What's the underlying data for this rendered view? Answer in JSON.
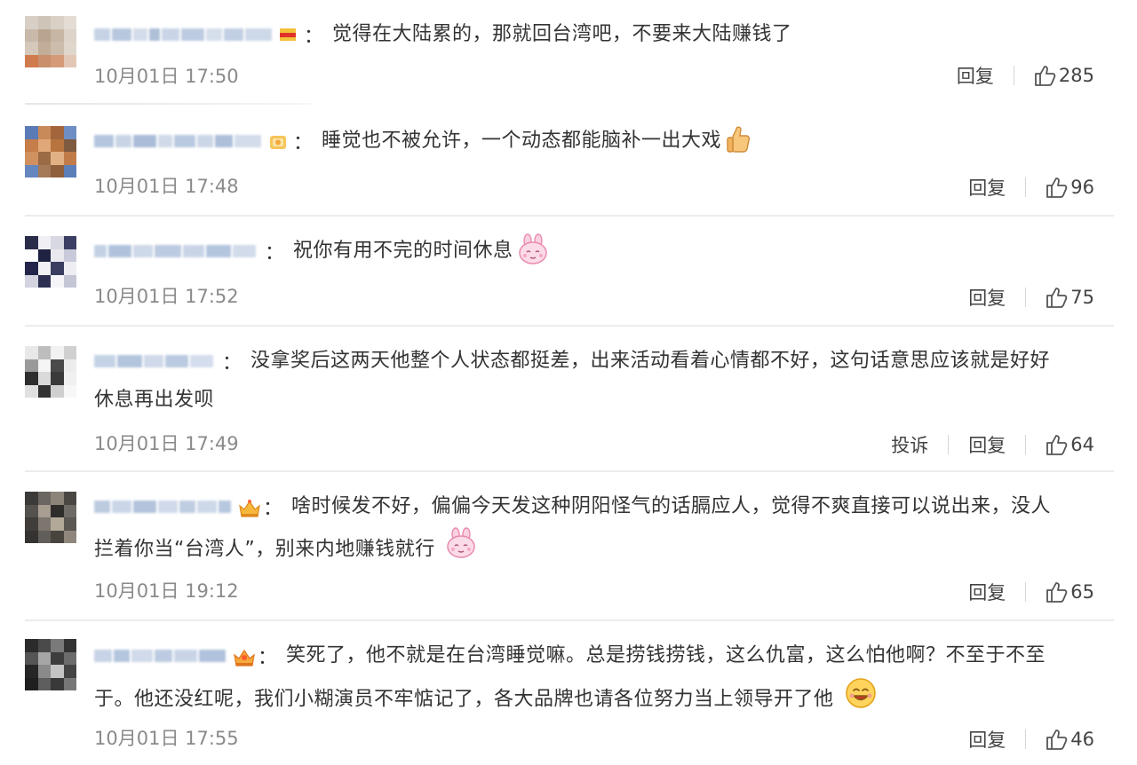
{
  "comments": [
    {
      "text": "觉得在大陆累的，那就回台湾吧，不要来大陆赚钱了",
      "text2": "",
      "time": "10月01日 17:50",
      "complaint": "",
      "reply": "回复",
      "likes": "285",
      "badge_icon": "flag-badge-icon",
      "emoji": ""
    },
    {
      "text": "睡觉也不被允许，一个动态都能脑补一出大戏",
      "text2": "",
      "time": "10月01日 17:48",
      "complaint": "",
      "reply": "回复",
      "likes": "96",
      "badge_icon": "gold-badge-icon",
      "emoji": "thumbs-up-emoji"
    },
    {
      "text": "祝你有用不完的时间休息",
      "text2": "",
      "time": "10月01日 17:52",
      "complaint": "",
      "reply": "回复",
      "likes": "75",
      "badge_icon": "",
      "emoji": "pink-bunny-emoji"
    },
    {
      "text": "没拿奖后这两天他整个人状态都挺差，出来活动看着心情都不好，这句话意思应该就是好好",
      "text2": "休息再出发呗",
      "time": "10月01日 17:49",
      "complaint": "投诉",
      "reply": "回复",
      "likes": "64",
      "badge_icon": "",
      "emoji": ""
    },
    {
      "text": "啥时候发不好，偏偏今天发这种阴阳怪气的话膈应人，觉得不爽直接可以说出来，没人",
      "text2": "拦着你当“台湾人”，别来内地赚钱就行",
      "time": "10月01日 19:12",
      "complaint": "",
      "reply": "回复",
      "likes": "65",
      "badge_icon": "crown-badge-icon",
      "emoji": "pink-bunny-emoji"
    },
    {
      "text": "笑死了，他不就是在台湾睡觉嘛。总是捞钱捞钱，这么仇富，这么怕他啊？不至于不至",
      "text2": "于。他还没红呢，我们小糊演员不牢惦记了，各大品牌也请各位努力当上领导开了他",
      "time": "10月01日 17:55",
      "complaint": "",
      "reply": "回复",
      "likes": "46",
      "badge_icon": "crown-badge-icon",
      "emoji": "smile-emoji"
    }
  ],
  "colon": "："
}
